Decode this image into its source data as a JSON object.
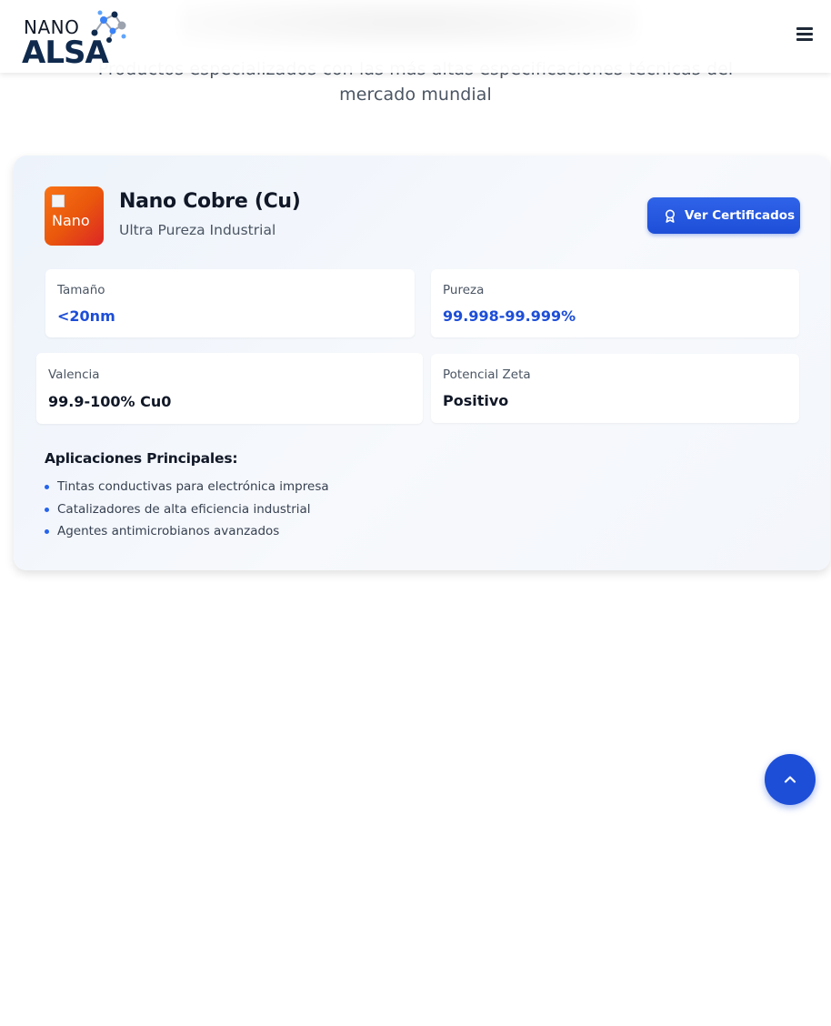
{
  "hero": {
    "subtitle_line1": "Productos especializados con las más altas especificaciones técnicas del",
    "subtitle_line2": "mercado mundial"
  },
  "header": {
    "logo_top": "NANO",
    "logo_bottom": "ALSA",
    "menu_icon": "hamburger-menu-icon"
  },
  "product": {
    "image_alt": "Nano",
    "title": "Nano Cobre (Cu)",
    "subtitle": "Ultra Pureza Industrial",
    "cert_button_label": "Ver Certificados",
    "cert_button_icon": "award-icon",
    "brand_gradient": [
      "#f97316",
      "#dc2626"
    ],
    "accent_color": "#1d4ed8",
    "specs": [
      {
        "label": "Tamaño",
        "value": "<20nm"
      },
      {
        "label": "Pureza",
        "value": "99.998-99.999%"
      },
      {
        "label": "Valencia",
        "value": "99.9-100% Cu0"
      },
      {
        "label": "Potencial Zeta",
        "value": "Positivo"
      }
    ],
    "applications_title": "Aplicaciones Principales:",
    "applications": [
      "Tintas conductivas para electrónica impresa",
      "Catalizadores de alta eficiencia industrial",
      "Agentes antimicrobianos avanzados"
    ]
  },
  "scroll_top_icon": "chevron-up-icon"
}
